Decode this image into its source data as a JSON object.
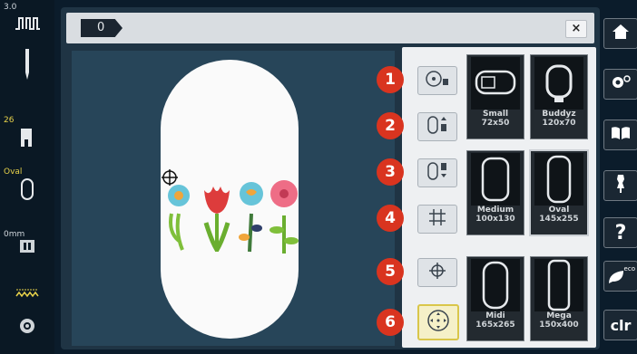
{
  "left_status": {
    "speed_value": "3.0",
    "needle_number": "26",
    "hoop_label": "Oval",
    "offset_value": "0mm"
  },
  "topbar": {
    "tab_label": "0",
    "close_label": "×"
  },
  "badges": [
    "1",
    "2",
    "3",
    "4",
    "5",
    "6"
  ],
  "hoops": [
    {
      "name": "Small",
      "size": "72x50"
    },
    {
      "name": "Buddyz",
      "size": "120x70"
    },
    {
      "name": "Medium",
      "size": "100x130"
    },
    {
      "name": "Oval",
      "size": "145x255"
    },
    {
      "name": "Midi",
      "size": "165x265"
    },
    {
      "name": "Mega",
      "size": "150x400"
    }
  ],
  "right_nav": {
    "help_label": "?",
    "eco_label": "eco",
    "clr_label": "clr"
  },
  "colors": {
    "background": "#0b1c2b",
    "panel": "#1f3444",
    "badge": "#d9341f",
    "active_highlight": "#d9c64a"
  },
  "selected_hoop": "Oval"
}
